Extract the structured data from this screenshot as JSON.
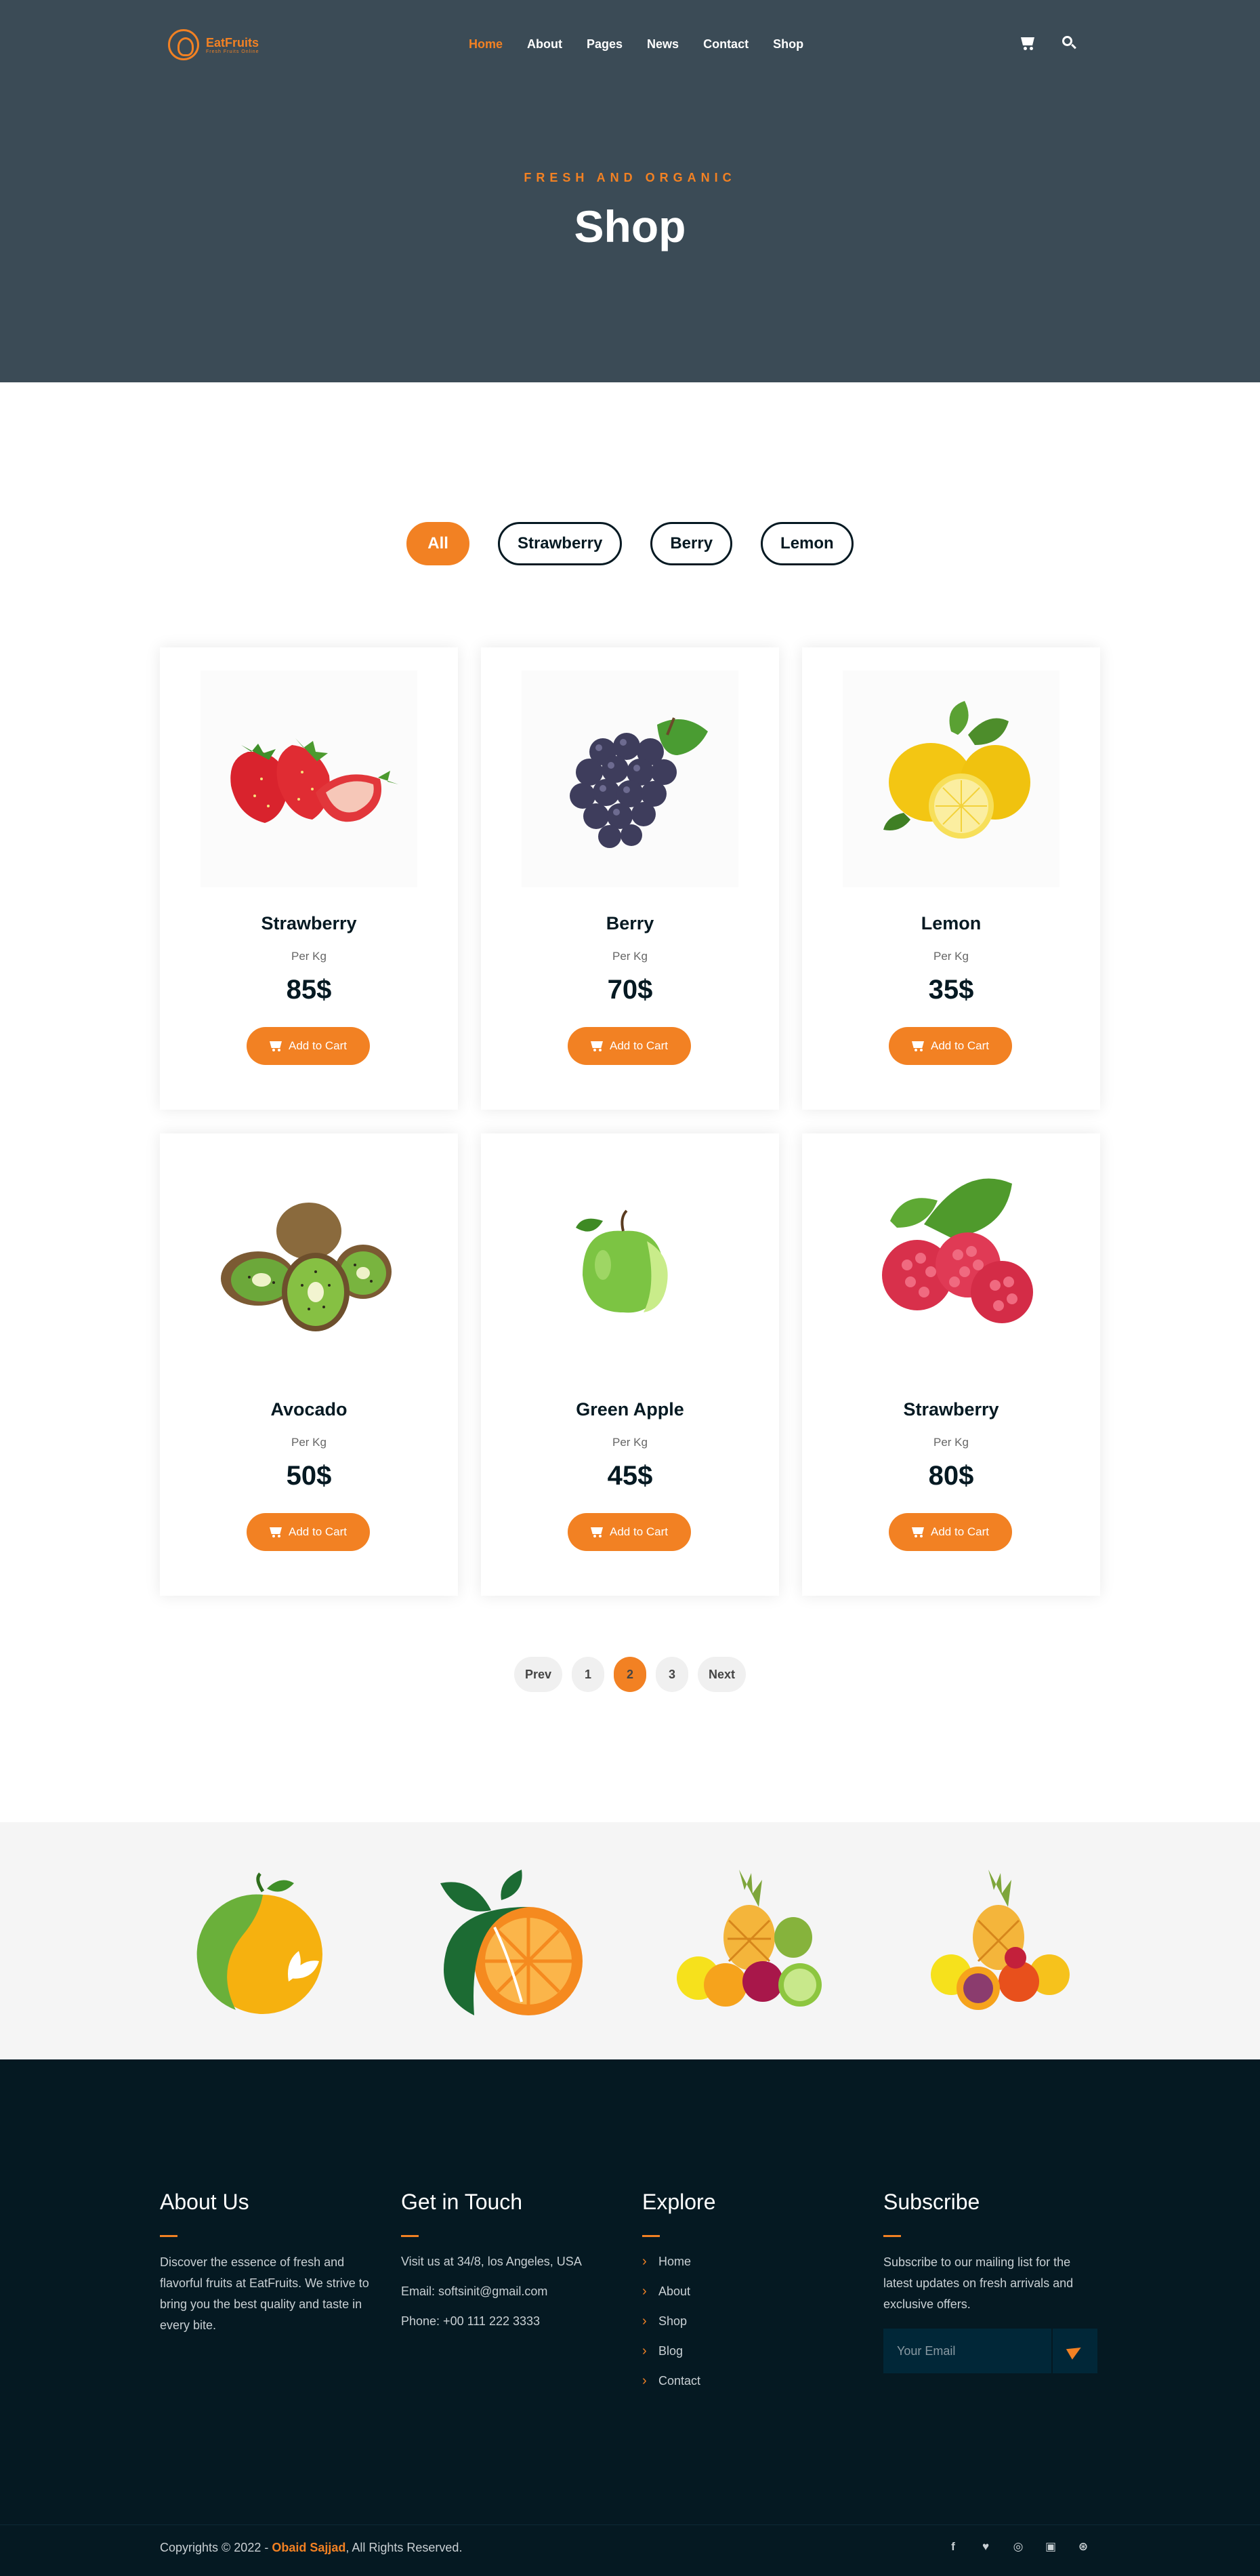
{
  "brand": {
    "name": "EatFruits",
    "tagline": "Fresh Fruits Online"
  },
  "nav": {
    "items": [
      {
        "label": "Home",
        "active": true
      },
      {
        "label": "About",
        "active": false
      },
      {
        "label": "Pages",
        "active": false
      },
      {
        "label": "News",
        "active": false
      },
      {
        "label": "Contact",
        "active": false
      },
      {
        "label": "Shop",
        "active": false
      }
    ],
    "icons": [
      "cart-icon",
      "search-icon"
    ]
  },
  "hero": {
    "subtitle": "FRESH AND ORGANIC",
    "title": "Shop"
  },
  "filters": {
    "items": [
      {
        "label": "All",
        "active": true
      },
      {
        "label": "Strawberry",
        "active": false
      },
      {
        "label": "Berry",
        "active": false
      },
      {
        "label": "Lemon",
        "active": false
      }
    ]
  },
  "products": [
    {
      "name": "Strawberry",
      "unit": "Per Kg",
      "price": "85$",
      "button": "Add to Cart",
      "image": "strawberry"
    },
    {
      "name": "Berry",
      "unit": "Per Kg",
      "price": "70$",
      "button": "Add to Cart",
      "image": "grapes"
    },
    {
      "name": "Lemon",
      "unit": "Per Kg",
      "price": "35$",
      "button": "Add to Cart",
      "image": "lemon"
    },
    {
      "name": "Avocado",
      "unit": "Per Kg",
      "price": "50$",
      "button": "Add to Cart",
      "image": "kiwi"
    },
    {
      "name": "Green Apple",
      "unit": "Per Kg",
      "price": "45$",
      "button": "Add to Cart",
      "image": "green-apple"
    },
    {
      "name": "Strawberry",
      "unit": "Per Kg",
      "price": "80$",
      "button": "Add to Cart",
      "image": "raspberry"
    }
  ],
  "pagination": {
    "prev": "Prev",
    "pages": [
      "1",
      "2",
      "3"
    ],
    "current": "2",
    "next": "Next"
  },
  "footer": {
    "about": {
      "title": "About Us",
      "text": "Discover the essence of fresh and flavorful fruits at EatFruits. We strive to bring you the best quality and taste in every bite."
    },
    "contact": {
      "title": "Get in Touch",
      "address": "Visit us at 34/8, los Angeles, USA",
      "email": "Email: softsinit@gmail.com",
      "phone": "Phone: +00 111 222 3333"
    },
    "explore": {
      "title": "Explore",
      "items": [
        "Home",
        "About",
        "Shop",
        "Blog",
        "Contact"
      ]
    },
    "subscribe": {
      "title": "Subscribe",
      "text": "Subscribe to our mailing list for the latest updates on fresh arrivals and exclusive offers.",
      "placeholder": "Your Email"
    },
    "copyright": {
      "prefix": "Copyrights © 2022 - ",
      "author": "Obaid Sajjad",
      "suffix": ", All Rights Reserved."
    },
    "socials": [
      "facebook-icon",
      "twitter-icon",
      "instagram-icon",
      "linkedin-icon",
      "dribbble-icon"
    ]
  },
  "colors": {
    "accent": "#f28123",
    "hero_bg": "#3b4b56",
    "footer_bg": "#051922",
    "text_dark": "#051922"
  }
}
